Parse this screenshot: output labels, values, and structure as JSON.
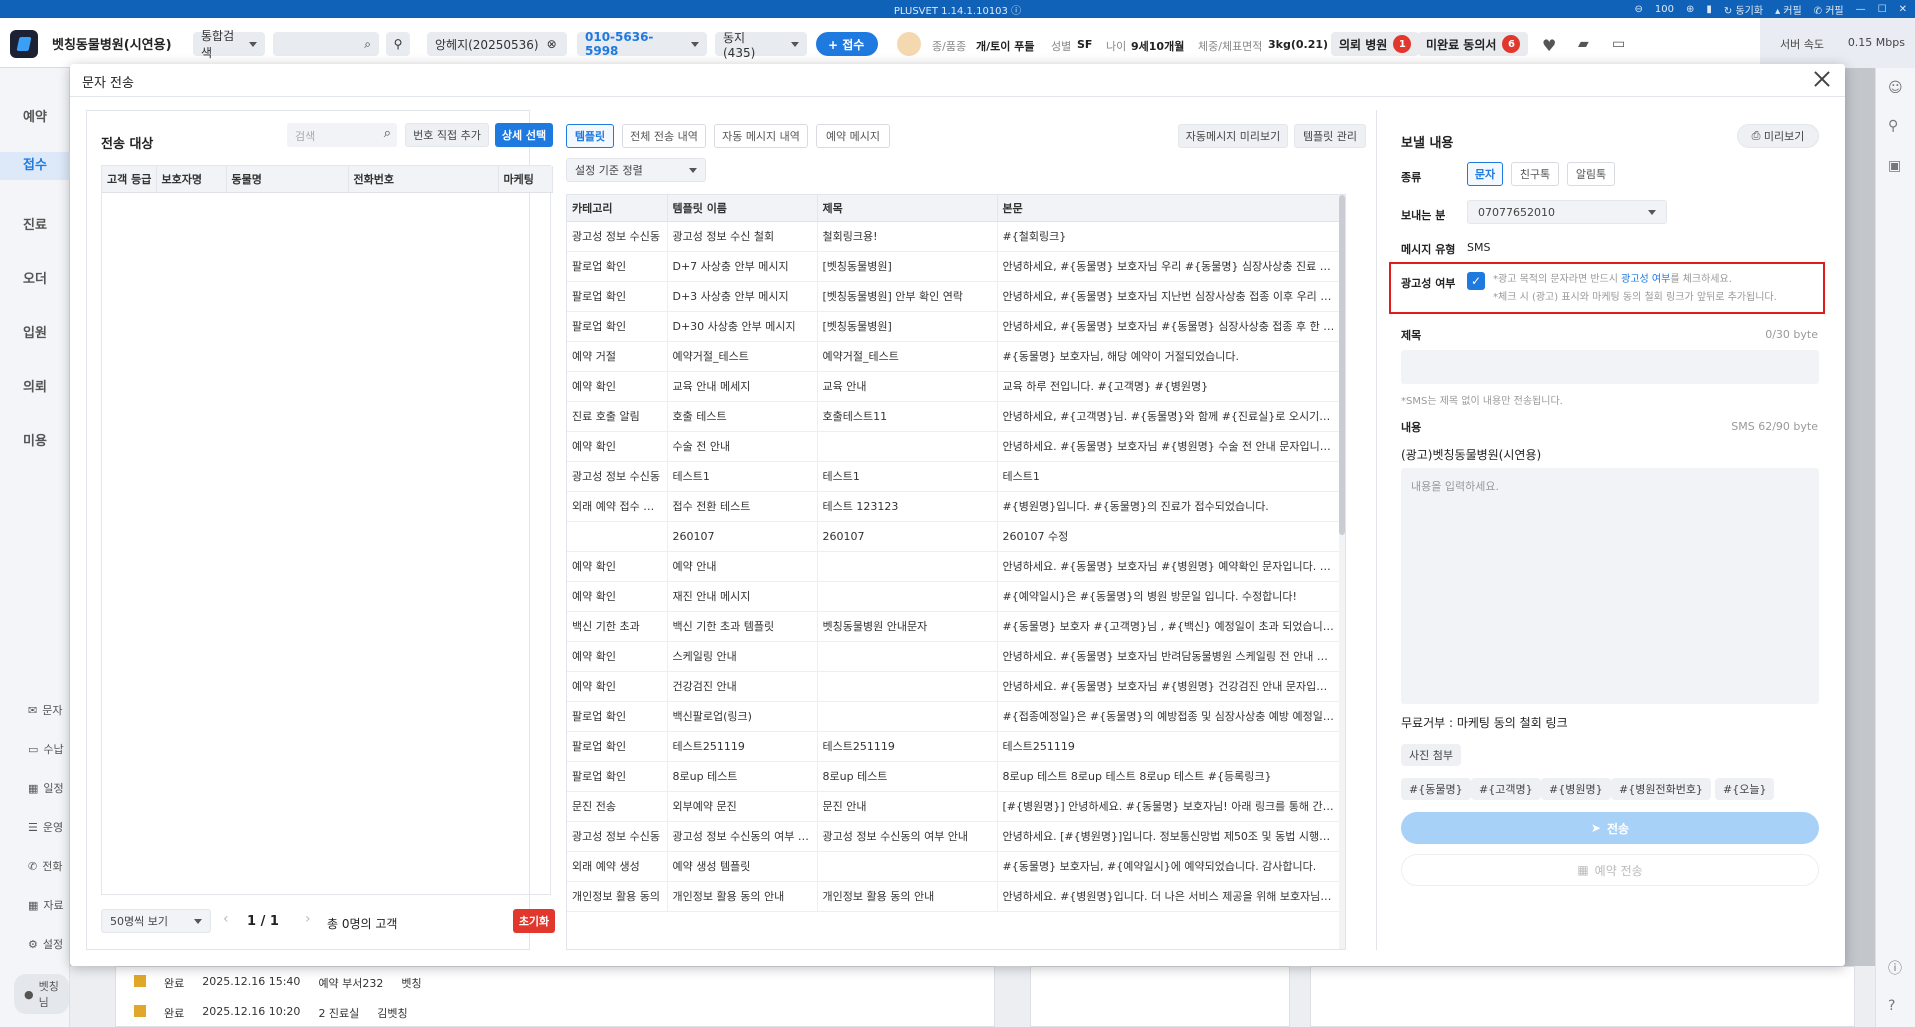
{
  "titlebar": {
    "title": "PLUSVET 1.14.1.10103",
    "info_icon": "info-icon",
    "volume": "100",
    "sync": "동기화",
    "reader": "커필",
    "call": "커필"
  },
  "appbar": {
    "hospital": "벳칭동물병원(시연용)",
    "search_scope": "통합검색",
    "patient": "앙헤지(20250536)",
    "phone": "010-5636-5998",
    "owner_select": "동지(435)",
    "register_btn": "+ 접수",
    "species_label": "종/품종",
    "species_value": "개/토이 푸들",
    "sex_label": "성별",
    "sex_value": "SF",
    "age_label": "나이",
    "age_value": "9세10개월",
    "weight_label": "체중/체표면적",
    "weight_value": "3kg(0.21)",
    "referral_label": "의뢰 병원",
    "referral_count": "1",
    "consent_label": "미완료 동의서",
    "consent_count": "6",
    "server_label": "서버 속도",
    "server_speed": "0.15 Mbps"
  },
  "leftnav": {
    "items": [
      "예약",
      "접수",
      "진료",
      "오더",
      "입원",
      "의뢰",
      "미용"
    ],
    "active": "접수",
    "bottom": [
      "문자",
      "수납",
      "일정",
      "운영",
      "전화",
      "자료",
      "설정"
    ],
    "user": "벳칭님"
  },
  "modal": {
    "title": "문자 전송",
    "left": {
      "title": "전송 대상",
      "search_placeholder": "검색",
      "add_number": "번호 직접 추가",
      "detail_select": "상세 선택",
      "columns": [
        "고객 등급",
        "보호자명",
        "동물명",
        "전화번호",
        "마케팅"
      ],
      "page_size": "50명씩 보기",
      "page": "1 / 1",
      "total": "총 0명의 고객",
      "reset": "초기화"
    },
    "middle": {
      "tabs": [
        "템플릿",
        "전체 전송 내역",
        "자동 메시지 내역",
        "예약 메시지"
      ],
      "auto_preview": "자동메시지 미리보기",
      "template_manage": "템플릿 관리",
      "sort": "설정 기준 정렬",
      "columns": [
        "카테고리",
        "템플릿 이름",
        "제목",
        "본문"
      ],
      "rows": [
        [
          "광고성 정보 수신동",
          "광고성 정보 수신 철회",
          "철회링크용!",
          "#{철회링크}"
        ],
        [
          "팔로업 확인",
          "D+7 사상충 안부 메시지",
          "[벳칭동물병원]",
          "안녕하세요, #{동물명} 보호자님 우리 #{동물명} 심장사상충 진료 후 ..."
        ],
        [
          "팔로업 확인",
          "D+3 사상충 안부 메시지",
          "[벳칭동물병원] 안부 확인 연락",
          "안녕하세요, #{동물명} 보호자님 지난번 심장사상충 접종 이후 우리 #..."
        ],
        [
          "팔로업 확인",
          "D+30 사상충 안부 메시지",
          "[벳칭동물병원]",
          "안녕하세요, #{동물명} 보호자님 #{동물명} 심장사상충 접종 후 한 달..."
        ],
        [
          "예약 거절",
          "예약거절_테스트",
          "예약거절_테스트",
          "#{동물명} 보호자님, 해당 예약이 거절되었습니다."
        ],
        [
          "예약 확인",
          "교육 안내 메세지",
          "교육 안내",
          "교육 하루 전입니다. #{고객명} #{병원명}"
        ],
        [
          "진료 호출 알림",
          "호출 테스트",
          "호출테스트11",
          "안녕하세요, #{고객명}님. #{동물명}와 함께 #{진료실}로 오시기바랍..."
        ],
        [
          "예약 확인",
          "수술 전 안내",
          "",
          "안녕하세요. #{동물명} 보호자님 #{병원명} 수술 전 안내 문자입니다. ..."
        ],
        [
          "광고성 정보 수신동",
          "테스트1",
          "테스트1",
          "테스트1"
        ],
        [
          "외래 예약 접수 전환",
          "접수 전환 테스트",
          "테스트 123123",
          "#{병원명}입니다. #{동물명}의 진료가 접수되었습니다."
        ],
        [
          "",
          "260107",
          "260107",
          "260107 수정"
        ],
        [
          "예약 확인",
          "예약 안내",
          "",
          "안녕하세요. #{동물명} 보호자님 #{병원명} 예약확인 문자입니다. #{..."
        ],
        [
          "예약 확인",
          "재진 안내 메시지",
          "",
          "#{예약일시}은 #{동물명}의 병원 방문일 입니다. 수정합니다!"
        ],
        [
          "백신 기한 초과",
          "백신 기한 초과 템플릿",
          "벳칭동물병원 안내문자",
          "#{동물명} 보호자 #{고객명}님 , #{백신} 예정일이 초과 되었습니다. ..."
        ],
        [
          "예약 확인",
          "스케일링 안내",
          "",
          "안녕하세요. #{동물명} 보호자님 반려담동물병원 스케일링 전 안내 문..."
        ],
        [
          "예약 확인",
          "건강검진 안내",
          "",
          "안녕하세요. #{동물명} 보호자님 #{병원명} 건강검진 안내 문자입니다..."
        ],
        [
          "팔로업 확인",
          "백신팔로업(링크)",
          "",
          "#{접종예정일}은 #{동물명}의 예방접종 및 심장사상충 예방 예정일 입..."
        ],
        [
          "팔로업 확인",
          "테스트251119",
          "테스트251119",
          "테스트251119"
        ],
        [
          "팔로업 확인",
          "8로up 테스트",
          "8로up 테스트",
          "8로up 테스트 8로up 테스트 8로up 테스트 #{등록링크}"
        ],
        [
          "문진 전송",
          "외부예약 문진",
          "문진 안내",
          "[#{병원명}] 안녕하세요. #{동물명} 보호자님! 아래 링크를 통해 간단..."
        ],
        [
          "광고성 정보 수신동",
          "광고성 정보 수신동의 여부 안내",
          "광고성 정보 수신동의 여부 안내",
          "안녕하세요. [#{병원명}]입니다. 정보통신망법 제50조 및 동법 시행령..."
        ],
        [
          "외래 예약 생성",
          "예약 생성 템플릿",
          "",
          "#{동물명} 보호자님, #{예약일시}에 예약되었습니다. 감사합니다."
        ],
        [
          "개인정보 활용 동의",
          "개인정보 활용 동의 안내",
          "개인정보 활용 동의 안내",
          "안녕하세요. #{병원명}입니다. 더 나은 서비스 제공을 위해 보호자님의..."
        ]
      ]
    },
    "right": {
      "title": "보낼 내용",
      "preview": "미리보기",
      "type_label": "종류",
      "types": [
        "문자",
        "친구톡",
        "알림톡"
      ],
      "sender_label": "보내는 분",
      "sender": "07077652010",
      "msgtype_label": "메시지 유형",
      "msgtype": "SMS",
      "ad_label": "광고성 여부",
      "ad_hint1_a": "*광고 목적의 문자라면 반드시 ",
      "ad_hint1_link": "광고성 여부",
      "ad_hint1_b": "를 체크하세요.",
      "ad_hint2": "*체크 시 (광고) 표시와 마케팅 동의 철회 링크가 앞뒤로 추가됩니다.",
      "subject_label": "제목",
      "subject_bytes": "0/30 byte",
      "subject_note": "*SMS는 제목 없이 내용만 전송됩니다.",
      "content_label": "내용",
      "content_bytes": "SMS 62/90 byte",
      "content_prefix": "(광고)벳칭동물병원(시연용)",
      "content_placeholder": "내용을 입력하세요.",
      "optout": "무료거부 : 마케팅 동의 철회 링크",
      "attach_photo": "사진 첨부",
      "vars": [
        "#{동물명}",
        "#{고객명}",
        "#{병원명}",
        "#{병원전화번호}",
        "#{오늘}"
      ],
      "send": "전송",
      "reserve_send": "예약 전송"
    }
  },
  "background": {
    "rows": [
      [
        "완료",
        "2025.12.16 15:40",
        "예약 부서232",
        "벳칭"
      ],
      [
        "완료",
        "2025.12.16 10:20",
        "2 진료실",
        "김벳칭"
      ]
    ]
  },
  "colors": {
    "primary": "#1f7ae0",
    "danger": "#e2372d",
    "titlebar": "#0f62b8"
  }
}
